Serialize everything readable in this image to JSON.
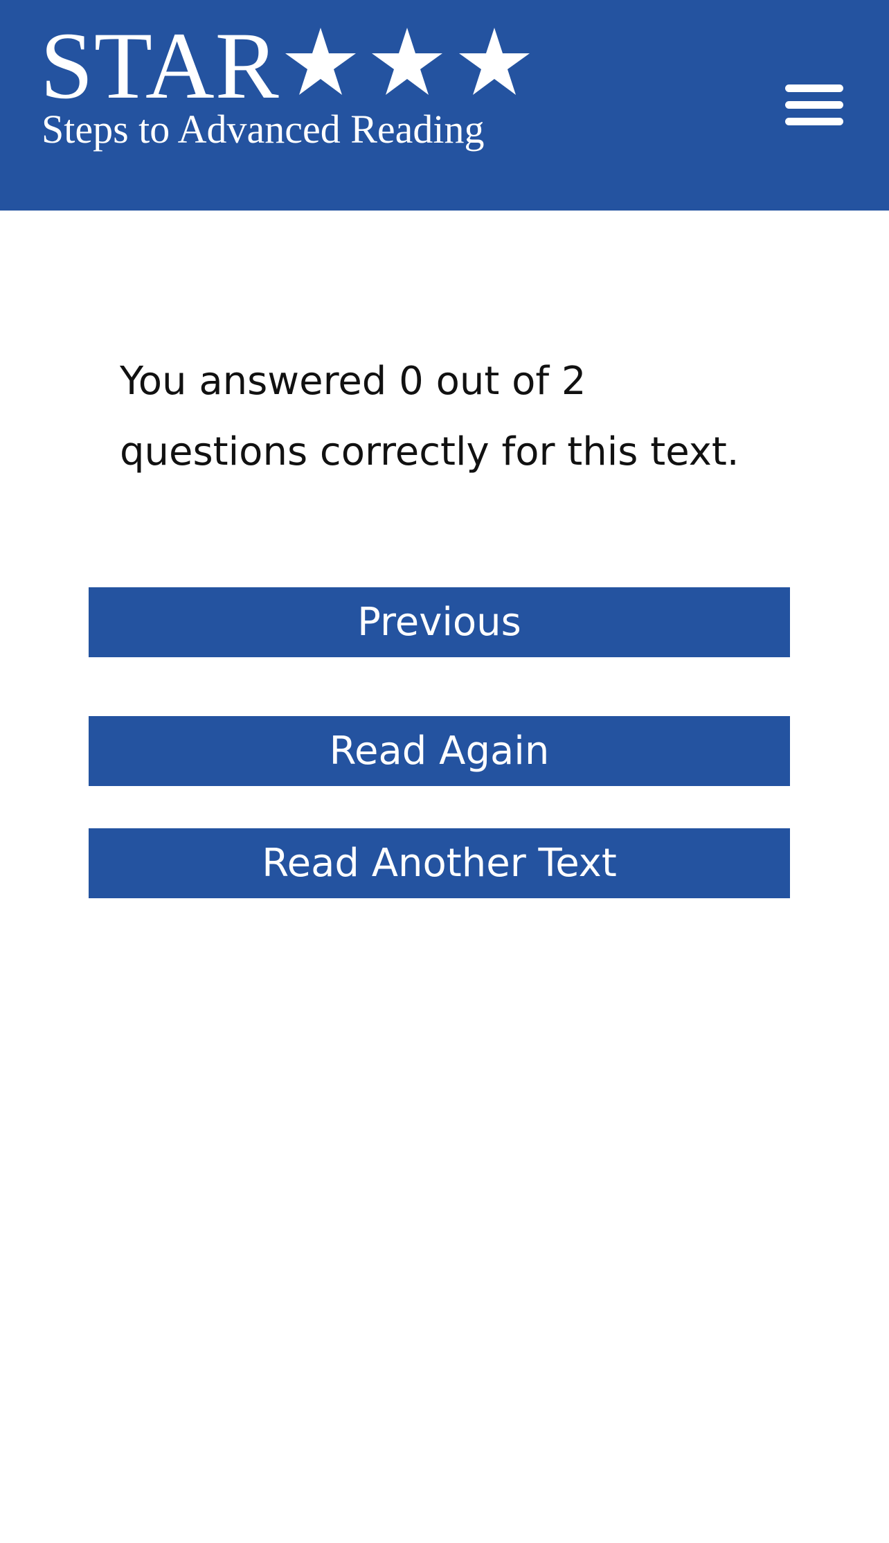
{
  "colors": {
    "brand": "#2453a0",
    "text": "#111111",
    "background": "#ffffff"
  },
  "header": {
    "logo": {
      "word": "STAR",
      "star_count": 3,
      "tagline": "Steps to Advanced Reading"
    },
    "menu_icon": "hamburger-menu-icon"
  },
  "main": {
    "result_text": "You answered 0 out of 2 questions correctly for this text.",
    "buttons": {
      "previous": "Previous",
      "read_again": "Read Again",
      "read_another": "Read Another Text"
    }
  }
}
